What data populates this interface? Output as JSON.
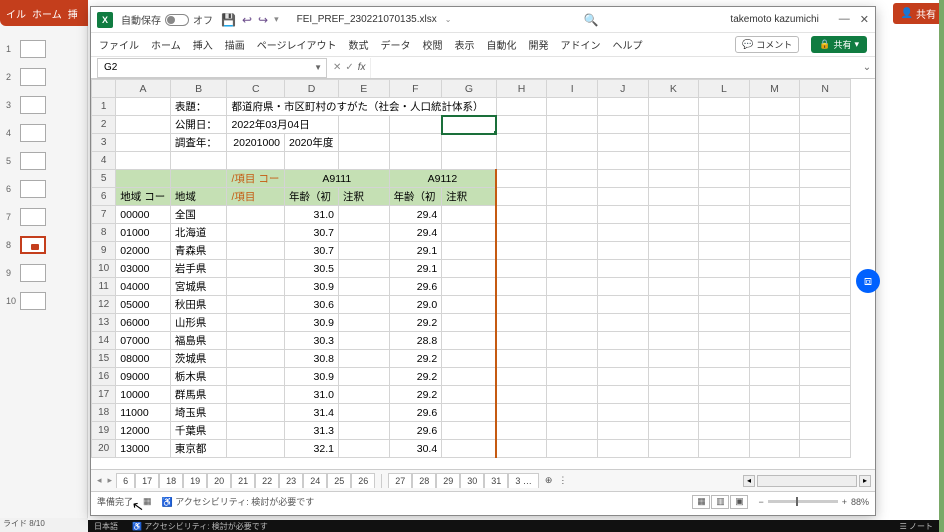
{
  "ppt": {
    "ribbon_tabs": [
      "イル",
      "ホーム",
      "挿"
    ],
    "slide_status": "ライド 8/10",
    "thumb_count": 10,
    "selected": 8
  },
  "share_top": "共有",
  "excel": {
    "autosave_label": "自動保存",
    "autosave_state": "オフ",
    "filename": "FEI_PREF_230221070135.xlsx",
    "user": "takemoto kazumichi",
    "menu": [
      "ファイル",
      "ホーム",
      "挿入",
      "描画",
      "ページレイアウト",
      "数式",
      "データ",
      "校閲",
      "表示",
      "自動化",
      "開発",
      "アドイン",
      "ヘルプ"
    ],
    "comment_btn": "コメント",
    "share_btn": "共有",
    "name_box": "G2",
    "columns": [
      "A",
      "B",
      "C",
      "D",
      "E",
      "F",
      "G",
      "H",
      "I",
      "J",
      "K",
      "L",
      "M",
      "N"
    ],
    "row1": {
      "label": "表題：",
      "value": "都道府県・市区町村のすがた（社会・人口統計体系）"
    },
    "row2": {
      "label": "公開日：",
      "value": "2022年03月04日"
    },
    "row3": {
      "label": "調査年：",
      "c": "20201000",
      "d": "2020年度"
    },
    "hdr5": {
      "c": "/項目 コー",
      "de": "A9111",
      "fg": "A9112"
    },
    "hdr6": {
      "a": "地域 コー",
      "b": "地域",
      "c": "/項目",
      "d": "年齢（初",
      "e": "注釈",
      "f": "年齢（初",
      "g": "注釈"
    },
    "rows": [
      {
        "n": 7,
        "code": "00000",
        "name": "全国",
        "v1": "31.0",
        "v2": "29.4"
      },
      {
        "n": 8,
        "code": "01000",
        "name": "北海道",
        "v1": "30.7",
        "v2": "29.4"
      },
      {
        "n": 9,
        "code": "02000",
        "name": "青森県",
        "v1": "30.7",
        "v2": "29.1"
      },
      {
        "n": 10,
        "code": "03000",
        "name": "岩手県",
        "v1": "30.5",
        "v2": "29.1"
      },
      {
        "n": 11,
        "code": "04000",
        "name": "宮城県",
        "v1": "30.9",
        "v2": "29.6"
      },
      {
        "n": 12,
        "code": "05000",
        "name": "秋田県",
        "v1": "30.6",
        "v2": "29.0"
      },
      {
        "n": 13,
        "code": "06000",
        "name": "山形県",
        "v1": "30.9",
        "v2": "29.2"
      },
      {
        "n": 14,
        "code": "07000",
        "name": "福島県",
        "v1": "30.3",
        "v2": "28.8"
      },
      {
        "n": 15,
        "code": "08000",
        "name": "茨城県",
        "v1": "30.8",
        "v2": "29.2"
      },
      {
        "n": 16,
        "code": "09000",
        "name": "栃木県",
        "v1": "30.9",
        "v2": "29.2"
      },
      {
        "n": 17,
        "code": "10000",
        "name": "群馬県",
        "v1": "31.0",
        "v2": "29.2"
      },
      {
        "n": 18,
        "code": "11000",
        "name": "埼玉県",
        "v1": "31.4",
        "v2": "29.6"
      },
      {
        "n": 19,
        "code": "12000",
        "name": "千葉県",
        "v1": "31.3",
        "v2": "29.6"
      },
      {
        "n": 20,
        "code": "13000",
        "name": "東京都",
        "v1": "32.1",
        "v2": "30.4"
      }
    ],
    "sheet_tabs": [
      "6",
      "17",
      "18",
      "19",
      "20",
      "21",
      "22",
      "23",
      "24",
      "25",
      "26"
    ],
    "sheet_tabs2": [
      "27",
      "28",
      "29",
      "30",
      "31",
      "3 …"
    ],
    "status_ready": "準備完了",
    "status_acc": "アクセシビリティ: 検討が必要です",
    "zoom_pct": "88%"
  },
  "outer_bottom": {
    "lang": "日本語",
    "acc": "アクセシビリティ: 検討が必要です",
    "notes": "ノート"
  }
}
